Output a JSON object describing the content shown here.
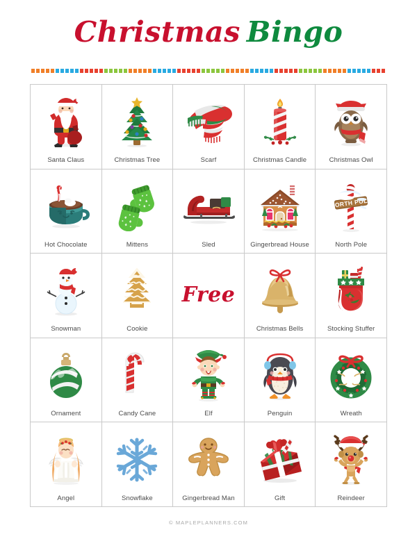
{
  "title": {
    "word_a": "Christmas",
    "word_b": "Bingo",
    "color_a": "#c8102e",
    "color_b": "#0e8a3e"
  },
  "divider": {
    "colors": [
      "#f07f28",
      "#29aae1",
      "#e8412f",
      "#8cc63e"
    ],
    "group_size": 5,
    "square_count": 73
  },
  "grid": {
    "rows": 5,
    "columns": 5,
    "border_color": "#c9c9c9",
    "label_color": "#4a4a4a",
    "cells": [
      {
        "label": "Santa Claus",
        "icon": "santa-claus-icon"
      },
      {
        "label": "Christmas Tree",
        "icon": "christmas-tree-icon"
      },
      {
        "label": "Scarf",
        "icon": "scarf-icon"
      },
      {
        "label": "Christmas Candle",
        "icon": "candle-icon"
      },
      {
        "label": "Christmas Owl",
        "icon": "owl-icon"
      },
      {
        "label": "Hot Chocolate",
        "icon": "hot-chocolate-icon"
      },
      {
        "label": "Mittens",
        "icon": "mittens-icon"
      },
      {
        "label": "Sled",
        "icon": "sled-icon"
      },
      {
        "label": "Gingerbread House",
        "icon": "gingerbread-house-icon"
      },
      {
        "label": "North Pole",
        "icon": "north-pole-icon"
      },
      {
        "label": "Snowman",
        "icon": "snowman-icon"
      },
      {
        "label": "Cookie",
        "icon": "cookie-icon"
      },
      {
        "label": "",
        "icon": "free-space",
        "free_text": "Free"
      },
      {
        "label": "Christmas Bells",
        "icon": "bell-icon"
      },
      {
        "label": "Stocking Stuffer",
        "icon": "stocking-icon"
      },
      {
        "label": "Ornament",
        "icon": "ornament-icon"
      },
      {
        "label": "Candy Cane",
        "icon": "candy-cane-icon"
      },
      {
        "label": "Elf",
        "icon": "elf-icon"
      },
      {
        "label": "Penguin",
        "icon": "penguin-icon"
      },
      {
        "label": "Wreath",
        "icon": "wreath-icon"
      },
      {
        "label": "Angel",
        "icon": "angel-icon"
      },
      {
        "label": "Snowflake",
        "icon": "snowflake-icon"
      },
      {
        "label": "Gingerbread Man",
        "icon": "gingerbread-man-icon"
      },
      {
        "label": "Gift",
        "icon": "gift-icon"
      },
      {
        "label": "Reindeer",
        "icon": "reindeer-icon"
      }
    ]
  },
  "north_pole_sign_text": "NORTH POLE",
  "footer": {
    "text": "© MAPLEPLANNERS.COM"
  }
}
